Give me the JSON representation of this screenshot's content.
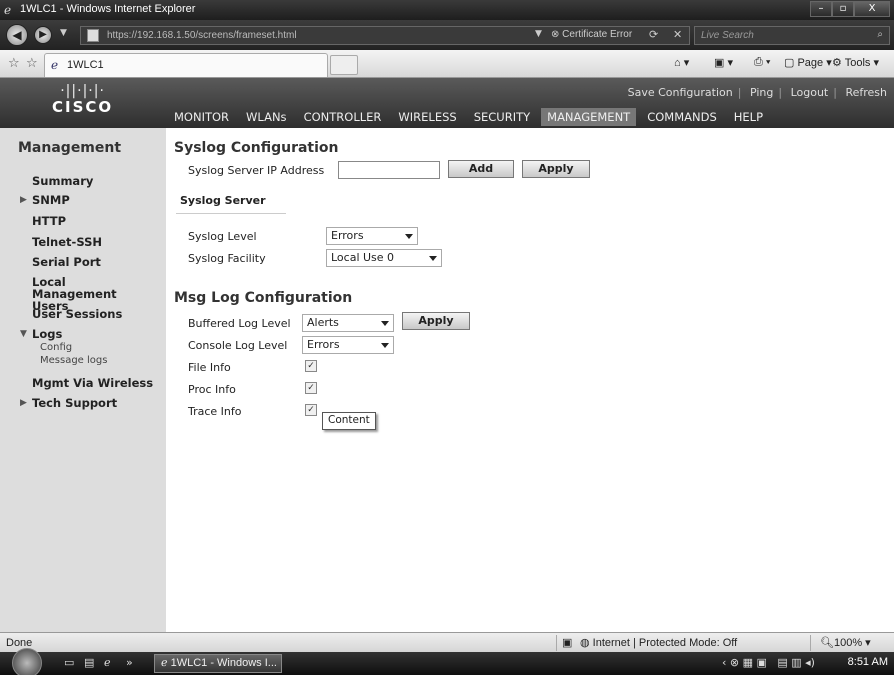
{
  "window": {
    "title": "1WLC1 - Windows Internet Explorer",
    "minimize": "–",
    "maximize": "▫",
    "close": "X"
  },
  "addressbar": {
    "url": "https://192.168.1.50/screens/frameset.html",
    "cert_error": "Certificate Error",
    "search_placeholder": "Live Search"
  },
  "tab": {
    "label": "1WLC1"
  },
  "commandbar": {
    "page": "Page",
    "tools": "Tools"
  },
  "cisco_header": {
    "logo_bars": "·||·|·|·",
    "logo_word": "CISCO",
    "links": [
      "Save Configuration",
      "Ping",
      "Logout",
      "Refresh"
    ],
    "menu": [
      {
        "label": "MONITOR"
      },
      {
        "label": "WLANs"
      },
      {
        "label": "CONTROLLER"
      },
      {
        "label": "WIRELESS"
      },
      {
        "label": "SECURITY"
      },
      {
        "label": "MANAGEMENT",
        "active": true
      },
      {
        "label": "COMMANDS"
      },
      {
        "label": "HELP"
      }
    ]
  },
  "sidebar": {
    "title": "Management",
    "items": [
      {
        "label": "Summary"
      },
      {
        "label": "SNMP",
        "collapsed": true
      },
      {
        "label": "HTTP"
      },
      {
        "label": "Telnet-SSH"
      },
      {
        "label": "Serial Port"
      },
      {
        "label": "Local Management Users"
      },
      {
        "label": "User Sessions"
      },
      {
        "label": "Logs",
        "expanded": true
      },
      {
        "label": "Config"
      },
      {
        "label": "Message logs"
      },
      {
        "label": "Mgmt Via Wireless"
      },
      {
        "label": "Tech Support",
        "collapsed": true
      }
    ]
  },
  "main": {
    "syslog_title": "Syslog Configuration",
    "server_ip_label": "Syslog Server IP Address",
    "server_ip_value": "",
    "add_label": "Add",
    "apply_label": "Apply",
    "syslog_server_heading": "Syslog Server",
    "syslog_level_label": "Syslog Level",
    "syslog_level_value": "Errors",
    "syslog_facility_label": "Syslog Facility",
    "syslog_facility_value": "Local Use 0",
    "msglog_title": "Msg Log Configuration",
    "buffered_label": "Buffered Log Level",
    "buffered_value": "Alerts",
    "msg_apply_label": "Apply",
    "console_label": "Console Log Level",
    "console_value": "Errors",
    "file_info_label": "File Info",
    "file_info_checked": true,
    "proc_info_label": "Proc Info",
    "proc_info_checked": true,
    "trace_info_label": "Trace Info",
    "trace_info_checked": true,
    "tooltip": "Content"
  },
  "statusbar": {
    "done": "Done",
    "zone": "Internet | Protected Mode: Off",
    "zoom": "100%"
  },
  "taskbar": {
    "task": "1WLC1 - Windows I...",
    "clock": "8:51 AM"
  }
}
